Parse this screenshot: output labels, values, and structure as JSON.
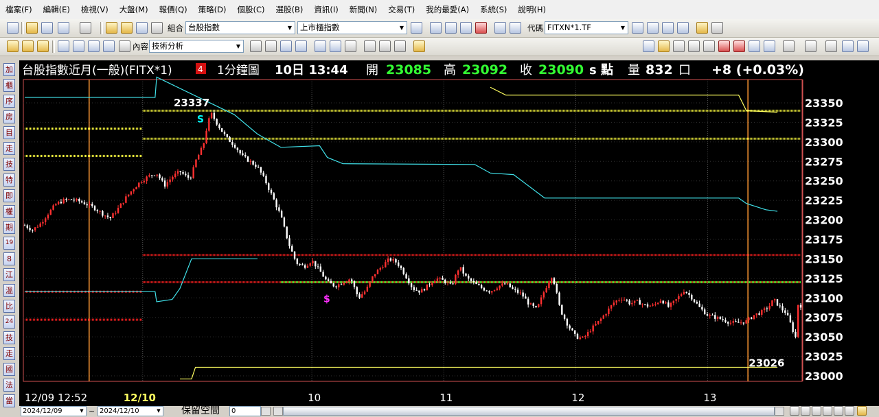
{
  "menu": [
    "檔案(F)",
    "編輯(E)",
    "檢視(V)",
    "大盤(M)",
    "報價(Q)",
    "策略(D)",
    "個股(C)",
    "選股(B)",
    "資訊(I)",
    "新聞(N)",
    "交易(T)",
    "我的最愛(A)",
    "系統(S)",
    "說明(H)"
  ],
  "toolbar1": {
    "group_label": "組合",
    "group_value": "台股指數",
    "market_value": "上市櫃指數",
    "code_label": "代碼",
    "code_value": "FITXN*1.TF"
  },
  "toolbar2": {
    "content_label": "內容",
    "content_value": "技術分析"
  },
  "left_tabs": [
    "加",
    "櫃",
    "序",
    "房",
    "目",
    "走",
    "技",
    "特",
    "即",
    "權",
    "期",
    "19",
    "8",
    "江",
    "溫",
    "比",
    "24",
    "技",
    "走",
    "國",
    "法",
    "當"
  ],
  "header": {
    "title": "台股指數近月(一般)(FITX*1)",
    "badge": "4",
    "period": "1分鐘圖",
    "date_time": "10日 13:44",
    "open_label": "開",
    "open": "23085",
    "high_label": "高",
    "high": "23092",
    "close_label": "收",
    "close": "23090",
    "unit": "s 點",
    "volume_label": "量",
    "volume": "832",
    "volume_unit": "口",
    "change": "+8 (+0.03%)"
  },
  "colors": {
    "background": "#000000",
    "candle_up": "#ff3030",
    "candle_down": "#ffffff",
    "yellow_level": "#ffff40",
    "red_level": "#ff2020",
    "green_level": "#30ff30",
    "cyan_line": "#40e0e8",
    "yellow_line": "#ffff60",
    "orange_marker": "#ff9933",
    "signal_s_cyan": "#00ffff",
    "signal_s_magenta": "#ff30ff"
  },
  "chart_data": {
    "type": "candlestick",
    "y_ticks": [
      23350,
      23325,
      23300,
      23275,
      23250,
      23225,
      23200,
      23175,
      23150,
      23125,
      23100,
      23075,
      23050,
      23025,
      23000
    ],
    "y_range": [
      22995,
      23370
    ],
    "x_labels": [
      "12/09 12:52",
      "12/10",
      "10",
      "11",
      "12",
      "13"
    ],
    "high_annotation": "23337",
    "low_annotation": "23026",
    "signal_markers": [
      "S",
      "$"
    ],
    "levels": {
      "yellow": [
        23340,
        23304,
        23317,
        23282
      ],
      "red": [
        23155,
        23120,
        23108,
        23072
      ],
      "green": [
        23120
      ]
    },
    "price_path": [
      [
        0,
        23193
      ],
      [
        0.01,
        23187
      ],
      [
        0.02,
        23195
      ],
      [
        0.03,
        23208
      ],
      [
        0.04,
        23220
      ],
      [
        0.05,
        23225
      ],
      [
        0.06,
        23226
      ],
      [
        0.07,
        23224
      ],
      [
        0.08,
        23220
      ],
      [
        0.09,
        23215
      ],
      [
        0.1,
        23208
      ],
      [
        0.11,
        23202
      ],
      [
        0.12,
        23214
      ],
      [
        0.13,
        23228
      ],
      [
        0.14,
        23240
      ],
      [
        0.15,
        23250
      ],
      [
        0.16,
        23256
      ],
      [
        0.17,
        23260
      ],
      [
        0.175,
        23252
      ],
      [
        0.18,
        23244
      ],
      [
        0.19,
        23255
      ],
      [
        0.2,
        23262
      ],
      [
        0.21,
        23254
      ],
      [
        0.215,
        23256
      ],
      [
        0.22,
        23275
      ],
      [
        0.23,
        23295
      ],
      [
        0.235,
        23320
      ],
      [
        0.24,
        23337
      ],
      [
        0.25,
        23320
      ],
      [
        0.26,
        23305
      ],
      [
        0.27,
        23296
      ],
      [
        0.28,
        23282
      ],
      [
        0.29,
        23275
      ],
      [
        0.3,
        23268
      ],
      [
        0.31,
        23250
      ],
      [
        0.32,
        23228
      ],
      [
        0.33,
        23205
      ],
      [
        0.34,
        23170
      ],
      [
        0.35,
        23145
      ],
      [
        0.36,
        23140
      ],
      [
        0.37,
        23148
      ],
      [
        0.38,
        23135
      ],
      [
        0.39,
        23120
      ],
      [
        0.4,
        23115
      ],
      [
        0.41,
        23120
      ],
      [
        0.42,
        23125
      ],
      [
        0.43,
        23100
      ],
      [
        0.44,
        23110
      ],
      [
        0.45,
        23130
      ],
      [
        0.46,
        23140
      ],
      [
        0.47,
        23150
      ],
      [
        0.48,
        23145
      ],
      [
        0.49,
        23130
      ],
      [
        0.5,
        23112
      ],
      [
        0.51,
        23108
      ],
      [
        0.52,
        23116
      ],
      [
        0.53,
        23125
      ],
      [
        0.54,
        23122
      ],
      [
        0.55,
        23115
      ],
      [
        0.56,
        23140
      ],
      [
        0.57,
        23125
      ],
      [
        0.58,
        23118
      ],
      [
        0.59,
        23112
      ],
      [
        0.6,
        23108
      ],
      [
        0.61,
        23115
      ],
      [
        0.62,
        23118
      ],
      [
        0.63,
        23110
      ],
      [
        0.64,
        23105
      ],
      [
        0.65,
        23092
      ],
      [
        0.66,
        23085
      ],
      [
        0.67,
        23110
      ],
      [
        0.68,
        23130
      ],
      [
        0.69,
        23085
      ],
      [
        0.7,
        23065
      ],
      [
        0.71,
        23050
      ],
      [
        0.72,
        23048
      ],
      [
        0.73,
        23060
      ],
      [
        0.74,
        23070
      ],
      [
        0.75,
        23082
      ],
      [
        0.76,
        23095
      ],
      [
        0.77,
        23100
      ],
      [
        0.78,
        23093
      ],
      [
        0.79,
        23095
      ],
      [
        0.8,
        23090
      ],
      [
        0.81,
        23090
      ],
      [
        0.82,
        23098
      ],
      [
        0.83,
        23088
      ],
      [
        0.84,
        23098
      ],
      [
        0.85,
        23110
      ],
      [
        0.86,
        23100
      ],
      [
        0.87,
        23087
      ],
      [
        0.88,
        23078
      ],
      [
        0.89,
        23075
      ],
      [
        0.9,
        23072
      ],
      [
        0.91,
        23068
      ],
      [
        0.92,
        23068
      ],
      [
        0.93,
        23070
      ],
      [
        0.94,
        23078
      ],
      [
        0.95,
        23082
      ],
      [
        0.96,
        23090
      ],
      [
        0.965,
        23098
      ],
      [
        0.97,
        23092
      ],
      [
        0.975,
        23086
      ],
      [
        0.98,
        23082
      ],
      [
        0.985,
        23072
      ],
      [
        0.99,
        23058
      ],
      [
        0.992,
        23030
      ],
      [
        0.995,
        23075
      ],
      [
        0.997,
        23095
      ],
      [
        1,
        23090
      ]
    ],
    "cyan_line": [
      [
        0,
        23357
      ],
      [
        0.168,
        23357
      ],
      [
        0.17,
        23383
      ],
      [
        0.27,
        23335
      ],
      [
        0.3,
        23310
      ],
      [
        0.33,
        23293
      ],
      [
        0.38,
        23295
      ],
      [
        0.39,
        23280
      ],
      [
        0.41,
        23272
      ],
      [
        0.58,
        23271
      ],
      [
        0.6,
        23260
      ],
      [
        0.63,
        23258
      ],
      [
        0.67,
        23228
      ],
      [
        0.92,
        23228
      ],
      [
        0.93,
        23221
      ],
      [
        0.955,
        23213
      ],
      [
        0.97,
        23211
      ]
    ],
    "cyan_line_early": [
      [
        0,
        23108
      ],
      [
        0.168,
        23108
      ],
      [
        0.17,
        23095
      ],
      [
        0.19,
        23098
      ],
      [
        0.2,
        23112
      ],
      [
        0.215,
        23150
      ],
      [
        0.22,
        23150
      ],
      [
        0.3,
        23150
      ]
    ],
    "yellow_line": [
      [
        0.6,
        23370
      ],
      [
        0.62,
        23360
      ],
      [
        0.92,
        23360
      ],
      [
        0.93,
        23340
      ],
      [
        0.97,
        23338
      ]
    ],
    "yellow_line_low": [
      [
        0.2,
        22996
      ],
      [
        0.215,
        22996
      ],
      [
        0.22,
        23011
      ],
      [
        0.97,
        23011
      ]
    ]
  },
  "bottom": {
    "date_from": "2024/12/09",
    "tilde": "~",
    "date_to": "2024/12/10",
    "reserve_label": "保留空間",
    "reserve_value": "0"
  }
}
